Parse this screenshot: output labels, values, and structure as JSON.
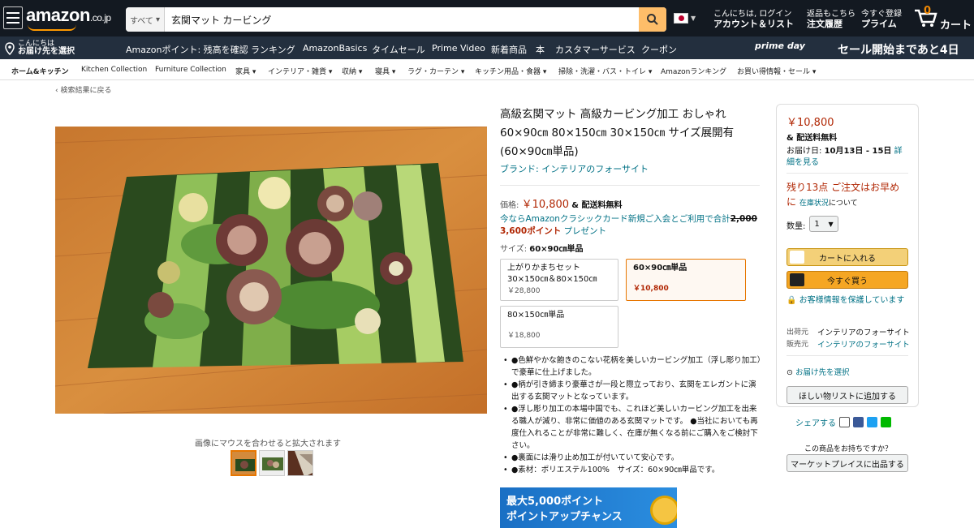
{
  "header": {
    "logo": "amazon",
    "logo_suffix": ".co.jp",
    "search_category": "すべて",
    "search_query": "玄関マット カービング",
    "account_line1": "こんにちは, ログイン",
    "account_line2": "アカウント＆リスト",
    "returns_line1": "返品もこちら",
    "returns_line2": "注文履歴",
    "prime_line1": "今すぐ登録",
    "prime_line2": "プライム",
    "cart_count": "0",
    "cart_label": "カート"
  },
  "subnav": {
    "deliver_line1": "こんにちは",
    "deliver_line2": "お届け先を選択",
    "items": [
      "Amazonポイント: 残高を確認",
      "ランキング",
      "AmazonBasics",
      "タイムセール",
      "Prime Video",
      "新着商品",
      "本",
      "カスタマーサービス",
      "クーポン"
    ],
    "prime_day": "prime day",
    "sale_text": "セール開始まであと4日"
  },
  "categories": [
    "ホーム&キッチン",
    "Kitchen Collection",
    "Furniture Collection",
    "家具",
    "インテリア・雑貨",
    "収納",
    "寝具",
    "ラグ・カーテン",
    "キッチン用品・食器",
    "掃除・洗濯・バス・トイレ",
    "Amazonランキング",
    "お買い得情報・セール"
  ],
  "back_link": "‹ 検索結果に戻る",
  "image_hint": "画像にマウスを合わせると拡大されます",
  "product": {
    "title": "高級玄関マット 高級カービング加工 おしゃれ 60×90㎝ 80×150㎝ 30×150㎝ サイズ展開有 (60×90㎝単品)",
    "brand": "ブランド: インテリアのフォーサイト",
    "price_label": "価格:",
    "price": "￥10,800",
    "shipping": "& 配送料無料",
    "promo_text": "今ならAmazonクラシックカード新規ご入会とご利用で合計",
    "promo_strike": "2,000",
    "promo_points": "3,600ポイント",
    "promo_tail": "プレゼント",
    "size_label": "サイズ:",
    "size_value": "60×90㎝単品",
    "options": [
      {
        "name": "上がりかまちセット",
        "sub": "30×150㎝＆80×150㎝",
        "price": "￥28,800"
      },
      {
        "name": "60×90㎝単品",
        "sub": "",
        "price": "￥10,800"
      },
      {
        "name": "80×150㎝単品",
        "sub": "",
        "price": "￥18,800"
      }
    ],
    "bullets": [
      "●色鮮やかな飽きのこない花柄を美しいカービング加工（浮し彫り加工）で豪華に仕上げました。",
      "●柄が引き締まり豪華さが一段と際立っており、玄関をエレガントに演出する玄関マットとなっています。",
      "●浮し彫り加工の本場中国でも、これほど美しいカービング加工を出来る職人が減り、非常に価値のある玄関マットです。 ●当社においても再度仕入れることが非常に難しく、在庫が無くなる前にご購入をご検討下さい。",
      "●裏面には滑り止め加工が付いていて安心です。",
      "●素材：ポリエステル100%　サイズ：60×90㎝単品です。"
    ],
    "banner_line1": "最大5,000ポイント",
    "banner_line2": "ポイントアップチャンス"
  },
  "buybox": {
    "price": "￥10,800",
    "shipping": "& 配送料無料",
    "delivery_label": "お届け日:",
    "delivery_date": "10月13日 - 15日",
    "delivery_link": "詳細を見る",
    "stock": "残り13点 ご注文はお早めに",
    "stock_link": "在庫状況",
    "stock_tail": "について",
    "qty_label": "数量:",
    "qty_value": "1",
    "add_to_cart": "カートに入れる",
    "buy_now": "今すぐ買う",
    "secure": "お客様情報を保護しています",
    "ships_from_label": "出荷元",
    "ships_from": "インテリアのフォーサイト",
    "sold_by_label": "販売元",
    "sold_by": "インテリアのフォーサイト",
    "deliver_to": "お届け先を選択",
    "wishlist": "ほしい物リストに追加する",
    "share": "シェアする",
    "sell_q": "この商品をお持ちですか？",
    "sell_btn": "マーケットプレイスに出品する"
  },
  "colors": {
    "header": "#131921",
    "subnav": "#232f3e",
    "price": "#b12704",
    "link": "#007185",
    "accent": "#febd69"
  }
}
